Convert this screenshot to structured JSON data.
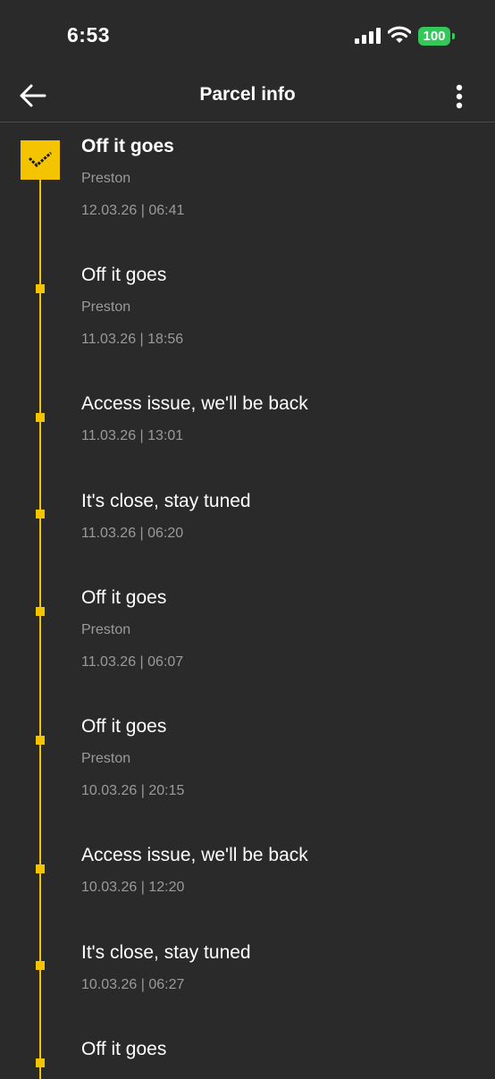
{
  "status_bar": {
    "time": "6:53",
    "battery_level": "100",
    "battery_color": "#34c759"
  },
  "header": {
    "title": "Parcel info",
    "back_icon": "arrow-left-icon",
    "menu_icon": "more-vertical-icon"
  },
  "accent_color": "#f5c400",
  "events": [
    {
      "title": "Off it goes",
      "location": "Preston",
      "datetime": "12.03.26 | 06:41",
      "current": true
    },
    {
      "title": "Off it goes",
      "location": "Preston",
      "datetime": "11.03.26 | 18:56"
    },
    {
      "title": "Access issue, we'll be back",
      "datetime": "11.03.26 | 13:01"
    },
    {
      "title": "It's close, stay tuned",
      "datetime": "11.03.26 | 06:20"
    },
    {
      "title": "Off it goes",
      "location": "Preston",
      "datetime": "11.03.26 | 06:07"
    },
    {
      "title": "Off it goes",
      "location": "Preston",
      "datetime": "10.03.26 | 20:15"
    },
    {
      "title": "Access issue, we'll be back",
      "datetime": "10.03.26 | 12:20"
    },
    {
      "title": "It's close, stay tuned",
      "datetime": "10.03.26 | 06:27"
    },
    {
      "title": "Off it goes"
    }
  ]
}
